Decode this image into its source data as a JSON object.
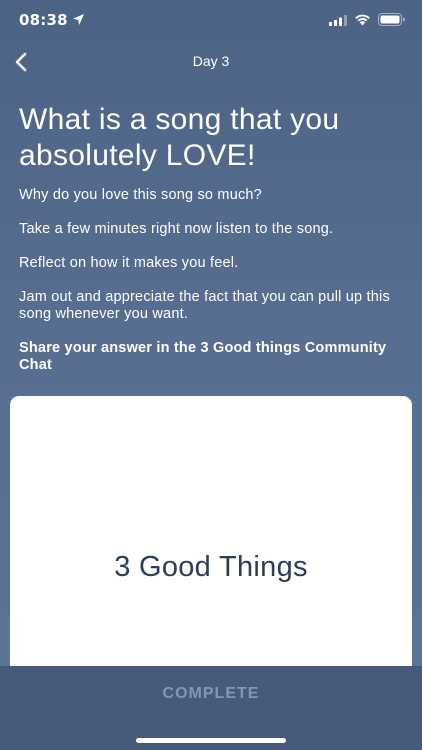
{
  "status_bar": {
    "time": "08:38",
    "icons": [
      "location-icon",
      "signal-icon",
      "wifi-icon",
      "battery-icon"
    ]
  },
  "nav": {
    "title": "Day 3",
    "back_icon": "chevron-left-icon"
  },
  "prompt": {
    "headline": "What is a song that you absolutely LOVE!",
    "paragraphs": [
      "Why do you love this song so much?",
      "Take a few minutes right now listen to the song.",
      "Reflect on how it makes you feel.",
      "Jam out and appreciate the fact that you can pull up this song whenever you want."
    ],
    "share_text": "Share your answer in the 3 Good things Community Chat"
  },
  "card": {
    "title": "3 Good Things"
  },
  "footer": {
    "complete_label": "COMPLETE"
  },
  "colors": {
    "background_top": "#4c6386",
    "background_bottom": "#5e7597",
    "card_text": "#2e3c58",
    "bottom_bar": "#465a7c",
    "complete_label": "#8696b0"
  }
}
